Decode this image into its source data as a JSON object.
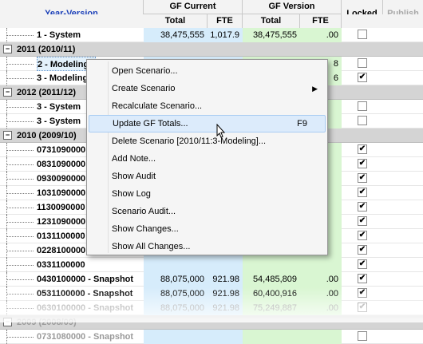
{
  "header": {
    "year_version": "Year-Version",
    "gf_current": "GF Current",
    "gf_version": "GF Version",
    "locked": "Locked",
    "publish": "Publish",
    "total": "Total",
    "fte": "FTE",
    "total2": "Total",
    "fte2": "FTE"
  },
  "rows": [
    {
      "name": "1 - System",
      "gtot": "38,475,555",
      "gfte": "1,017.9",
      "vtot": "38,475,555",
      "vfte": ".00",
      "locked": ""
    },
    {
      "group": "2011  (2010/11)"
    },
    {
      "name": "2 - Modeling",
      "gtot": "",
      "gfte": "",
      "vtot": "",
      "vfte": "8",
      "locked": "",
      "sel": true
    },
    {
      "name": "3 - Modeling",
      "gtot": "",
      "gfte": "",
      "vtot": "",
      "vfte": "6",
      "locked": "✔"
    },
    {
      "group": "2012  (2011/12)"
    },
    {
      "name": "3 - System",
      "gtot": "",
      "gfte": "",
      "vtot": "",
      "vfte": "",
      "locked": ""
    },
    {
      "name": "3 - System",
      "gtot": "",
      "gfte": "",
      "vtot": "",
      "vfte": "",
      "locked": ""
    },
    {
      "group": "2010  (2009/10)"
    },
    {
      "name": "0731090000",
      "gtot": "",
      "gfte": "",
      "vtot": "",
      "vfte": "",
      "locked": "✔"
    },
    {
      "name": "0831090000",
      "gtot": "",
      "gfte": "",
      "vtot": "",
      "vfte": "",
      "locked": "✔"
    },
    {
      "name": "0930090000",
      "gtot": "",
      "gfte": "",
      "vtot": "",
      "vfte": "",
      "locked": "✔"
    },
    {
      "name": "1031090000",
      "gtot": "",
      "gfte": "",
      "vtot": "",
      "vfte": "",
      "locked": "✔"
    },
    {
      "name": "1130090000",
      "gtot": "",
      "gfte": "",
      "vtot": "",
      "vfte": "",
      "locked": "✔"
    },
    {
      "name": "1231090000",
      "gtot": "",
      "gfte": "",
      "vtot": "",
      "vfte": "",
      "locked": "✔"
    },
    {
      "name": "0131100000",
      "gtot": "",
      "gfte": "",
      "vtot": "",
      "vfte": "",
      "locked": "✔"
    },
    {
      "name": "0228100000",
      "gtot": "",
      "gfte": "",
      "vtot": "",
      "vfte": "",
      "locked": "✔"
    },
    {
      "name": "0331100000",
      "gtot": "",
      "gfte": "",
      "vtot": "",
      "vfte": "",
      "locked": "✔"
    },
    {
      "name": "0430100000 - Snapshot",
      "gtot": "88,075,000",
      "gfte": "921.98",
      "vtot": "54,485,809",
      "vfte": ".00",
      "locked": "✔"
    },
    {
      "name": "0531100000 - Snapshot",
      "gtot": "88,075,000",
      "gfte": "921.98",
      "vtot": "60,400,916",
      "vfte": ".00",
      "locked": "✔"
    },
    {
      "name": "0630100000 - Snapshot",
      "gtot": "88,075,000",
      "gfte": "921.98",
      "vtot": "75,249,887",
      "vfte": ".00",
      "locked": "✔",
      "fade": true
    },
    {
      "group": "2009  (2008/09)",
      "fade": true
    },
    {
      "name": "0731080000 - Snapshot",
      "gtot": "",
      "gfte": "",
      "vtot": "",
      "vfte": "",
      "locked": "",
      "fade": true
    }
  ],
  "menu": {
    "items": [
      {
        "label": "Open Scenario..."
      },
      {
        "label": "Create Scenario",
        "arrow": "▶"
      },
      {
        "label": "Recalculate Scenario..."
      },
      {
        "label": "Update GF Totals...",
        "shortcut": "F9",
        "highlight": true
      },
      {
        "label": "Delete Scenario [2010/11:3-Modeling]..."
      },
      {
        "label": "Add Note..."
      },
      {
        "label": "Show Audit"
      },
      {
        "label": "Show Log"
      },
      {
        "label": "Scenario Audit..."
      },
      {
        "label": "Show Changes..."
      },
      {
        "label": "Show All Changes..."
      }
    ]
  }
}
